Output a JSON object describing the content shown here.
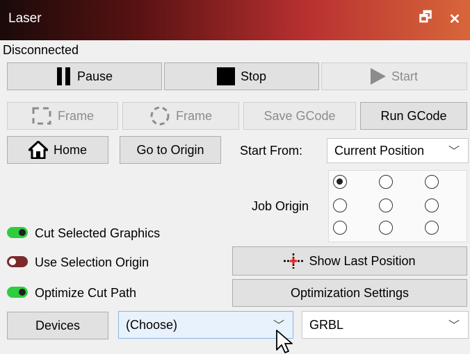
{
  "window": {
    "title": "Laser",
    "restore_icon": "restore-icon",
    "close_icon": "close-icon"
  },
  "status": "Disconnected",
  "buttons": {
    "pause": "Pause",
    "stop": "Stop",
    "start": "Start",
    "frame_rect": "Frame",
    "frame_circle": "Frame",
    "save_gcode": "Save GCode",
    "run_gcode": "Run GCode",
    "home": "Home",
    "go_to_origin": "Go to Origin",
    "show_last_position": "Show Last Position",
    "optimization_settings": "Optimization Settings",
    "devices": "Devices"
  },
  "start_from": {
    "label": "Start From:",
    "value": "Current Position"
  },
  "job_origin": {
    "label": "Job Origin",
    "selected": "top-left"
  },
  "toggles": [
    {
      "label": "Cut Selected Graphics",
      "on": true
    },
    {
      "label": "Use Selection Origin",
      "on": false
    },
    {
      "label": "Optimize Cut Path",
      "on": true
    }
  ],
  "device_select": {
    "value": "(Choose)"
  },
  "controller_select": {
    "value": "GRBL"
  },
  "colors": {
    "toggle_on": "#2ecc40",
    "toggle_off": "#7a2a2a",
    "crosshair": "#e02020"
  }
}
